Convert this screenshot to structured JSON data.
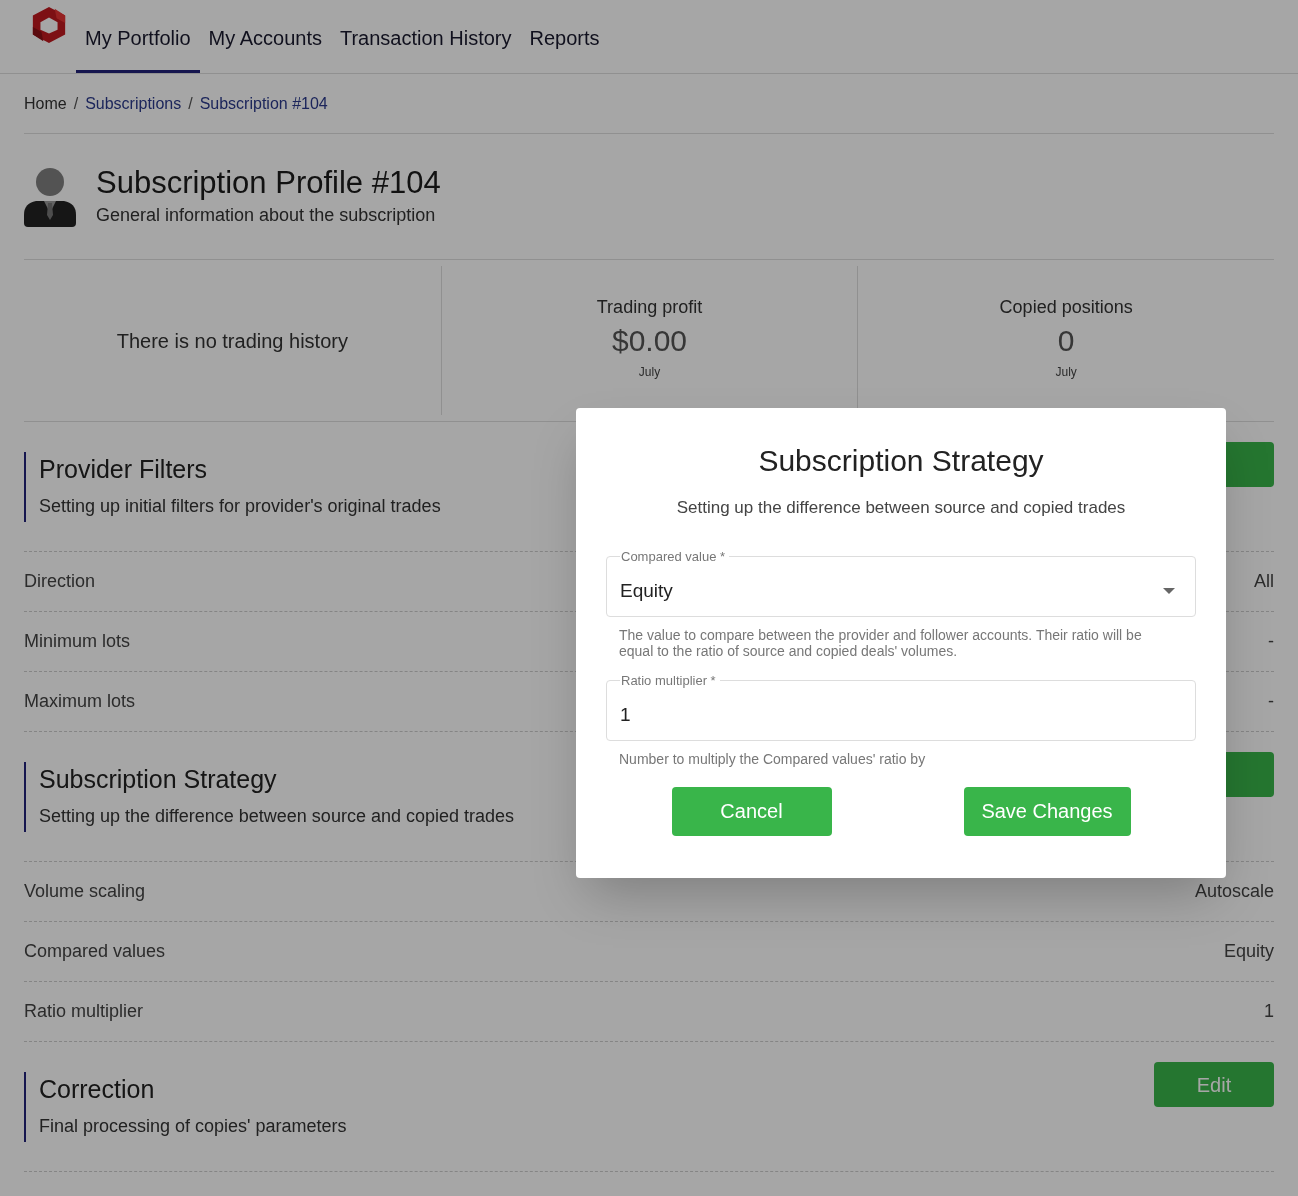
{
  "nav": {
    "items": [
      {
        "label": "My Portfolio",
        "selected": true
      },
      {
        "label": "My Accounts",
        "selected": false
      },
      {
        "label": "Transaction History",
        "selected": false
      },
      {
        "label": "Reports",
        "selected": false
      }
    ]
  },
  "breadcrumb": [
    {
      "label": "Home"
    },
    {
      "separator": "/",
      "label": "Subscriptions"
    },
    {
      "separator": "/",
      "label": "Subscription #104"
    }
  ],
  "profile": {
    "title": "Subscription Profile #104",
    "subtitle": "General information about the subscription"
  },
  "stats": [
    {
      "kind": "message",
      "text": "There is no trading history"
    },
    {
      "kind": "stat",
      "label": "Trading profit",
      "value": "$0.00",
      "period": "July"
    },
    {
      "kind": "stat",
      "label": "Copied positions",
      "value": "0",
      "period": "July"
    }
  ],
  "sections": [
    {
      "title": "Provider Filters",
      "subtitle": "Setting up initial filters for provider's original trades",
      "rows": [
        {
          "label": "Direction",
          "value": "All"
        },
        {
          "label": "Minimum lots",
          "value": "-"
        },
        {
          "label": "Maximum lots",
          "value": "-"
        }
      ]
    },
    {
      "title": "Subscription Strategy",
      "subtitle": "Setting up the difference between source and copied trades",
      "rows": [
        {
          "label": "Volume scaling",
          "value": "Autoscale"
        },
        {
          "label": "Compared values",
          "value": "Equity"
        },
        {
          "label": "Ratio multiplier",
          "value": "1"
        }
      ]
    },
    {
      "title": "Correction",
      "subtitle": "Final processing of copies' parameters",
      "button": "Edit"
    }
  ],
  "dialog": {
    "title": "Subscription Strategy",
    "subtitle": "Setting up the difference between source and copied trades",
    "fields": [
      {
        "kind": "select",
        "label": "Compared value *",
        "value": "Equity",
        "help": "The value to compare between the provider and follower accounts. Their ratio will be equal to the ratio of source and copied deals' volumes."
      },
      {
        "kind": "input",
        "label": "Ratio multiplier *",
        "value": "1",
        "help": "Number to multiply the Compared values' ratio by"
      }
    ],
    "buttons": [
      "Cancel",
      "Save Changes"
    ]
  }
}
